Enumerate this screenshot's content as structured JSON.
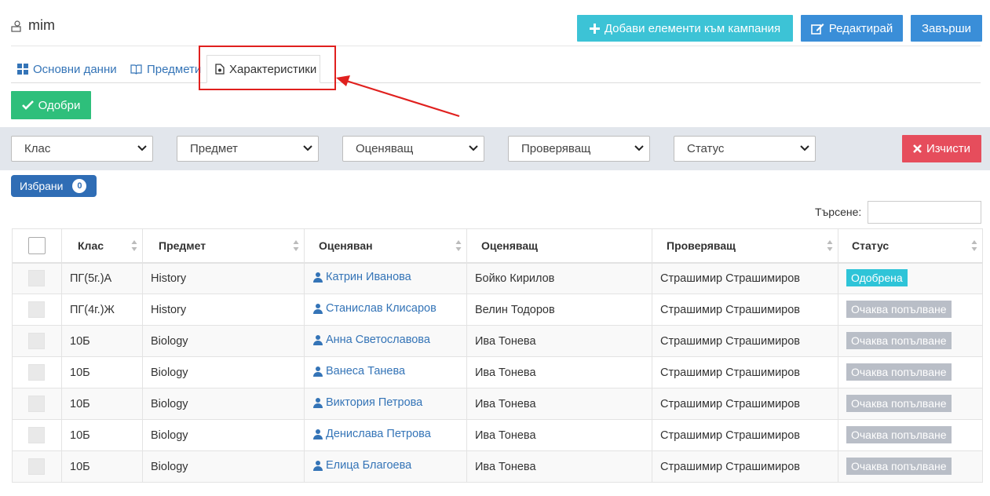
{
  "header": {
    "title": "mim",
    "add_button": "Добави елементи към кампания",
    "edit_button": "Редактирай",
    "finish_button": "Завърши"
  },
  "tabs": [
    {
      "label": "Основни данни",
      "icon": "grid-icon"
    },
    {
      "label": "Предмети",
      "icon": "book-icon"
    },
    {
      "label": "Характеристики",
      "icon": "document-icon",
      "active": true
    }
  ],
  "approve_button": "Одобри",
  "filters": {
    "class": "Клас",
    "subject": "Предмет",
    "evaluator": "Оценяващ",
    "checker": "Проверяващ",
    "status": "Статус",
    "clear_button": "Изчисти"
  },
  "chosen": {
    "label": "Избрани",
    "count": "0"
  },
  "search": {
    "label": "Търсене:",
    "value": ""
  },
  "table": {
    "headers": [
      "Клас",
      "Предмет",
      "Оценяван",
      "Оценяващ",
      "Проверяващ",
      "Статус"
    ],
    "rows": [
      {
        "class": "ПГ(5г.)А",
        "subject": "History",
        "evaluated": "Катрин Иванова",
        "evaluator": "Бойко Кирилов",
        "checker": "Страшимир Страшимиров",
        "status": "Одобрена",
        "status_type": "approved"
      },
      {
        "class": "ПГ(4г.)Ж",
        "subject": "History",
        "evaluated": "Станислав Клисаров",
        "evaluator": "Велин Тодоров",
        "checker": "Страшимир Страшимиров",
        "status": "Очаква попълване",
        "status_type": "pending"
      },
      {
        "class": "10Б",
        "subject": "Biology",
        "evaluated": "Анна Светославова",
        "evaluator": "Ива Тонева",
        "checker": "Страшимир Страшимиров",
        "status": "Очаква попълване",
        "status_type": "pending"
      },
      {
        "class": "10Б",
        "subject": "Biology",
        "evaluated": "Ванеса Танева",
        "evaluator": "Ива Тонева",
        "checker": "Страшимир Страшимиров",
        "status": "Очаква попълване",
        "status_type": "pending"
      },
      {
        "class": "10Б",
        "subject": "Biology",
        "evaluated": "Виктория Петрова",
        "evaluator": "Ива Тонева",
        "checker": "Страшимир Страшимиров",
        "status": "Очаква попълване",
        "status_type": "pending"
      },
      {
        "class": "10Б",
        "subject": "Biology",
        "evaluated": "Денислава Петрова",
        "evaluator": "Ива Тонева",
        "checker": "Страшимир Страшимиров",
        "status": "Очаква попълване",
        "status_type": "pending"
      },
      {
        "class": "10Б",
        "subject": "Biology",
        "evaluated": "Елица Благоева",
        "evaluator": "Ива Тонева",
        "checker": "Страшимир Страшимиров",
        "status": "Очаква попълване",
        "status_type": "pending"
      }
    ]
  },
  "colors": {
    "accent": "#3474b7",
    "approved": "#2ec4d8",
    "pending": "#b9bec7",
    "approve_button": "#2ebf7b",
    "clear_button": "#e64d5c",
    "highlight": "#e0201e"
  }
}
